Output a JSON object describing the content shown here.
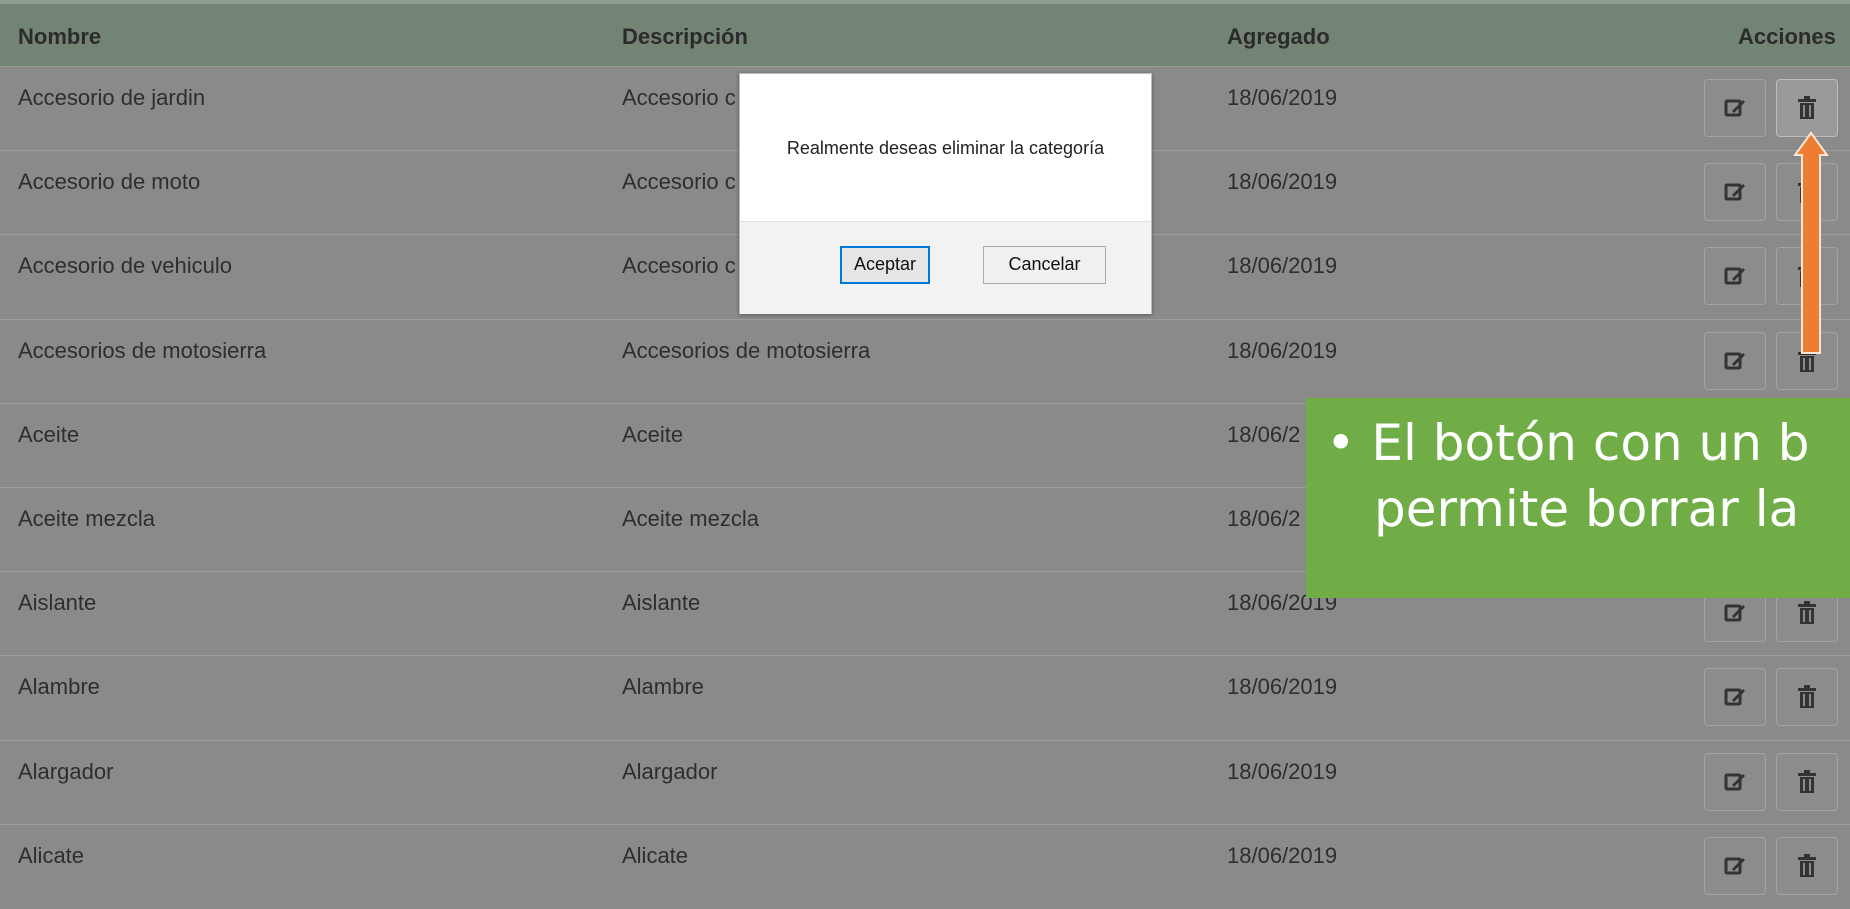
{
  "table": {
    "headers": {
      "nombre": "Nombre",
      "descripcion": "Descripción",
      "agregado": "Agregado",
      "acciones": "Acciones"
    },
    "rows": [
      {
        "nombre": "Accesorio de jardin",
        "descripcion": "Accesorio c",
        "agregado": "18/06/2019"
      },
      {
        "nombre": "Accesorio de moto",
        "descripcion": "Accesorio c",
        "agregado": "18/06/2019"
      },
      {
        "nombre": "Accesorio de vehiculo",
        "descripcion": "Accesorio c",
        "agregado": "18/06/2019"
      },
      {
        "nombre": "Accesorios de motosierra",
        "descripcion": "Accesorios de motosierra",
        "agregado": "18/06/2019"
      },
      {
        "nombre": "Aceite",
        "descripcion": "Aceite",
        "agregado": "18/06/2"
      },
      {
        "nombre": "Aceite mezcla",
        "descripcion": "Aceite mezcla",
        "agregado": "18/06/2"
      },
      {
        "nombre": "Aislante",
        "descripcion": "Aislante",
        "agregado": "18/06/2019"
      },
      {
        "nombre": "Alambre",
        "descripcion": "Alambre",
        "agregado": "18/06/2019"
      },
      {
        "nombre": "Alargador",
        "descripcion": "Alargador",
        "agregado": "18/06/2019"
      },
      {
        "nombre": "Alicate",
        "descripcion": "Alicate",
        "agregado": "18/06/2019"
      }
    ],
    "action_icons": {
      "edit": "edit-icon",
      "delete": "trash-icon"
    }
  },
  "dialog": {
    "message": "Realmente deseas eliminar la categoría",
    "accept_label": "Aceptar",
    "cancel_label": "Cancelar"
  },
  "callout": {
    "line1": "• El botón con un b",
    "line2": "permite borrar la"
  },
  "colors": {
    "callout": "#70ad47",
    "arrow": "#ed7d31",
    "header": "#748474"
  }
}
